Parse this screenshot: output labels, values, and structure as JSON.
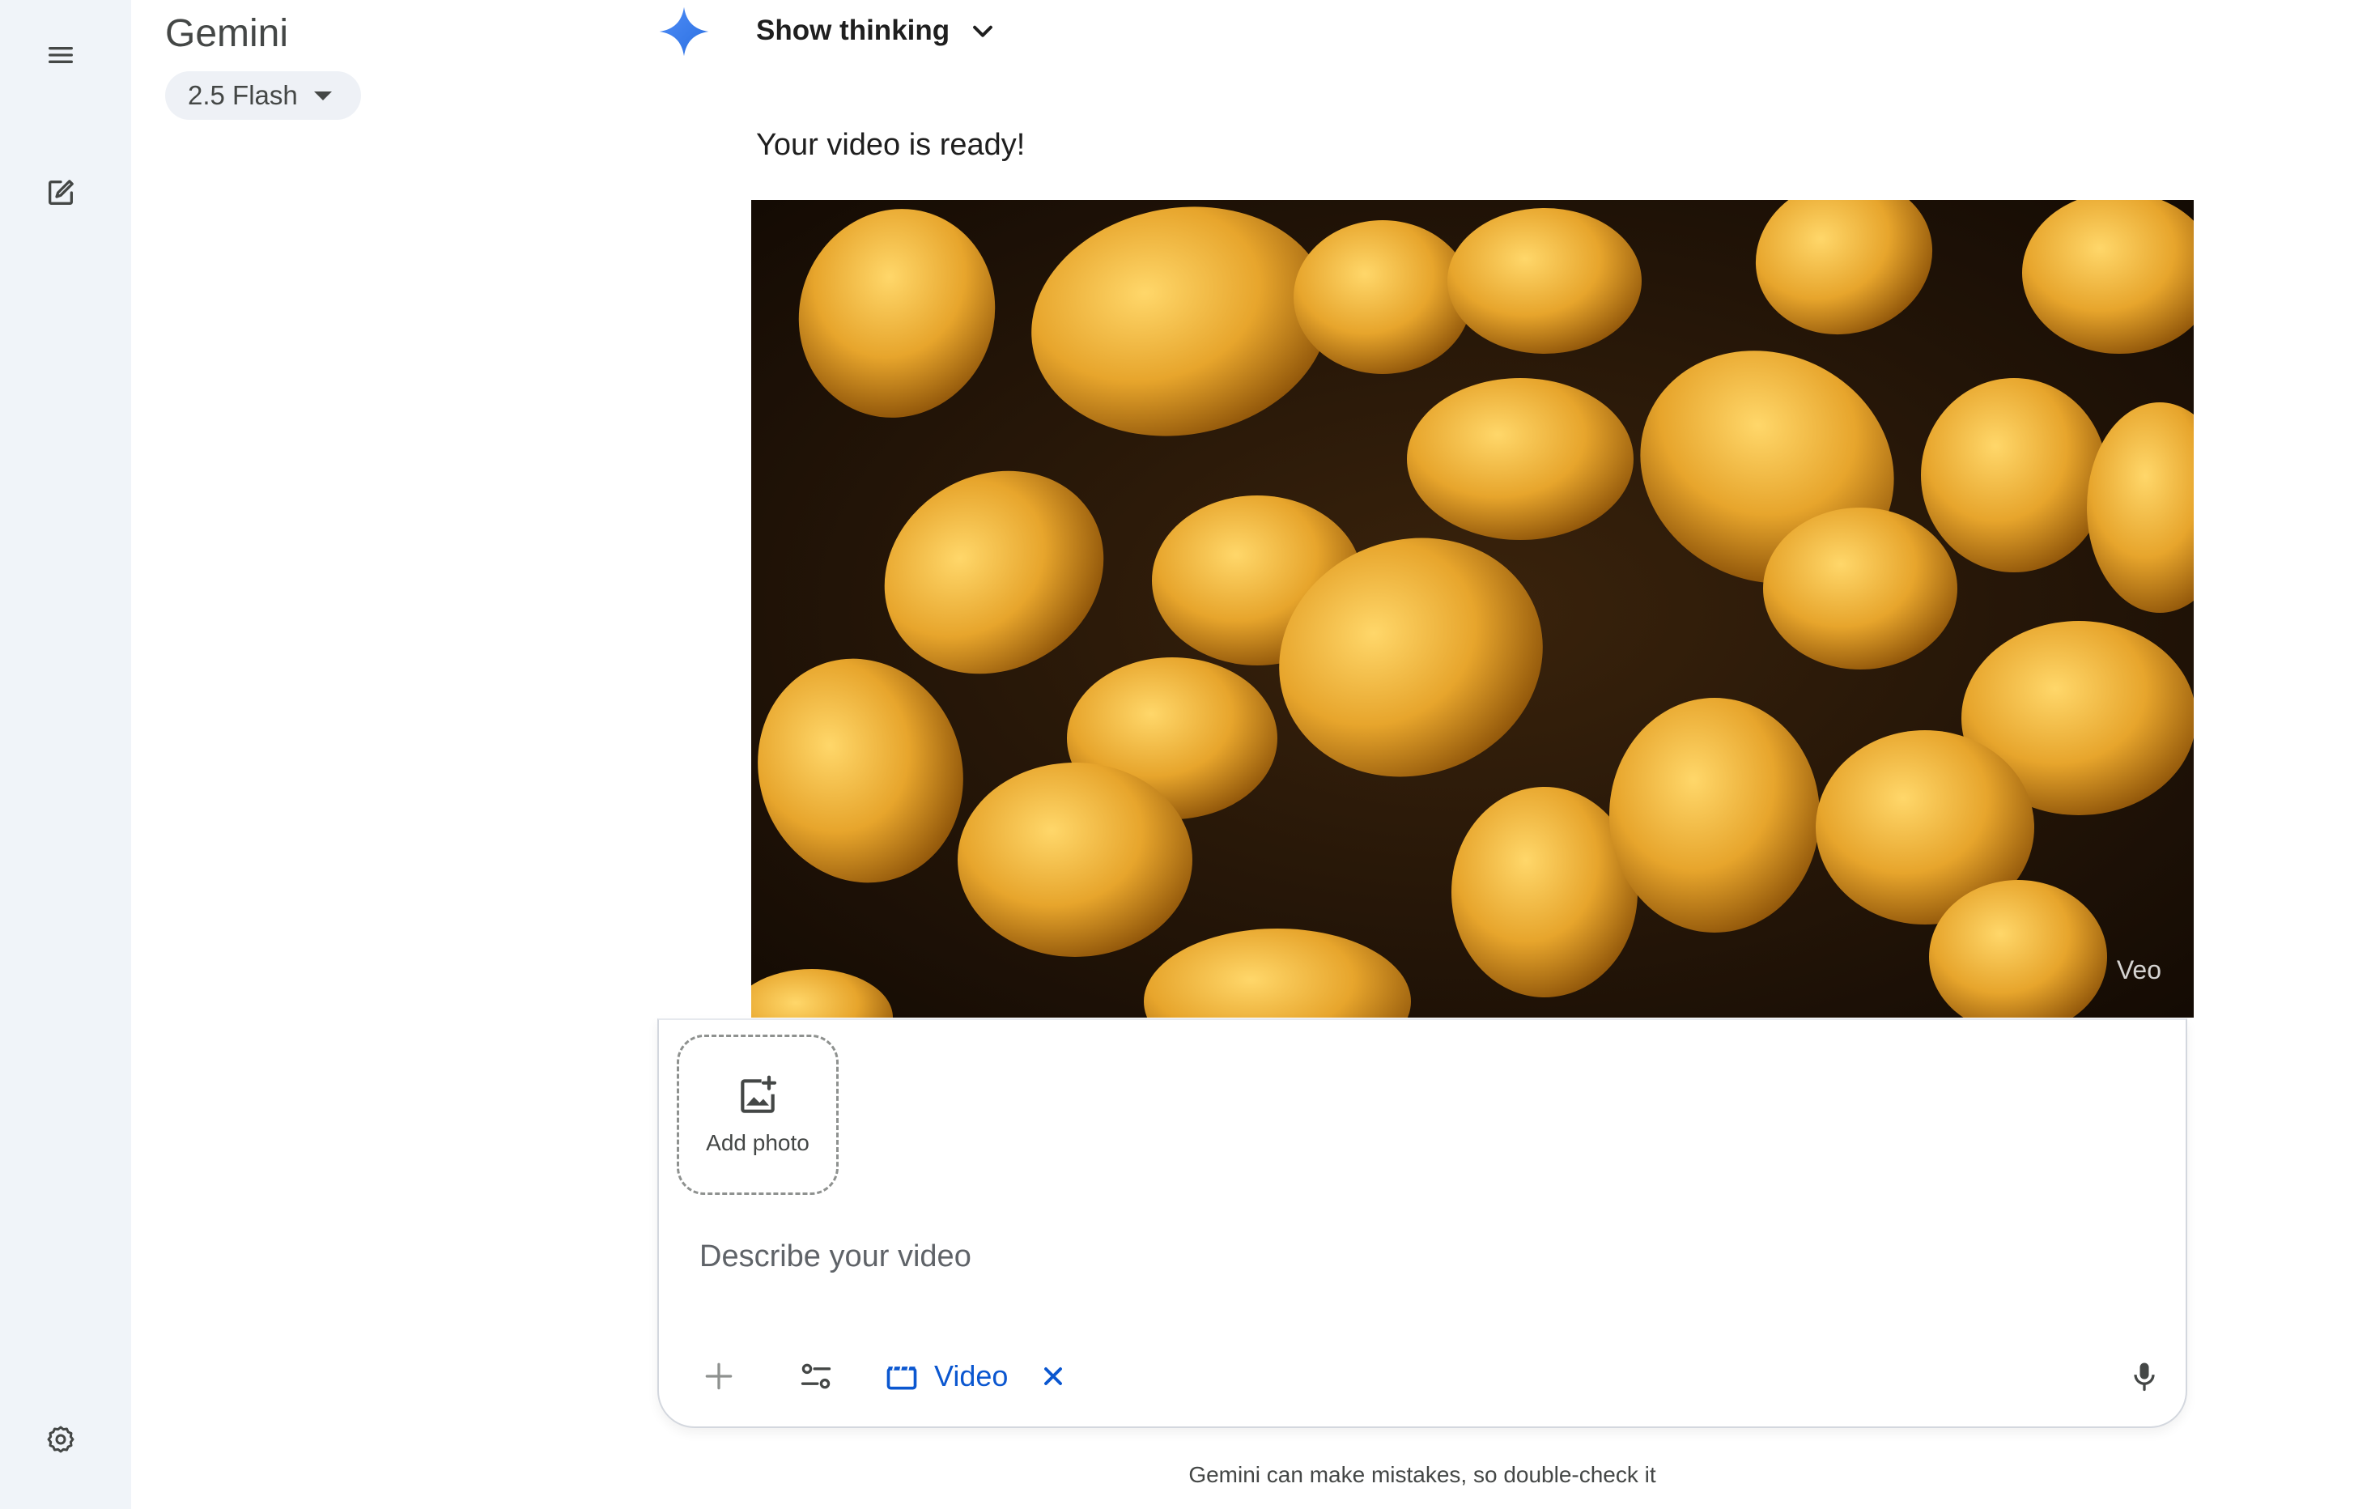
{
  "app": {
    "title": "Gemini",
    "model": "2.5 Flash"
  },
  "rail": {
    "menu_icon": "menu-icon",
    "new_chat_icon": "edit-icon",
    "settings_icon": "gear-icon"
  },
  "response": {
    "show_thinking": "Show thinking",
    "message": "Your video is ready!",
    "video_watermark": "Veo"
  },
  "composer": {
    "add_photo": "Add photo",
    "placeholder": "Describe your video",
    "video_chip": "Video"
  },
  "footer": {
    "disclaimer": "Gemini can make mistakes, so double-check it"
  },
  "colors": {
    "rail_bg": "#f0f4f9",
    "accent": "#0b57d0",
    "spark": "#4285f4"
  }
}
